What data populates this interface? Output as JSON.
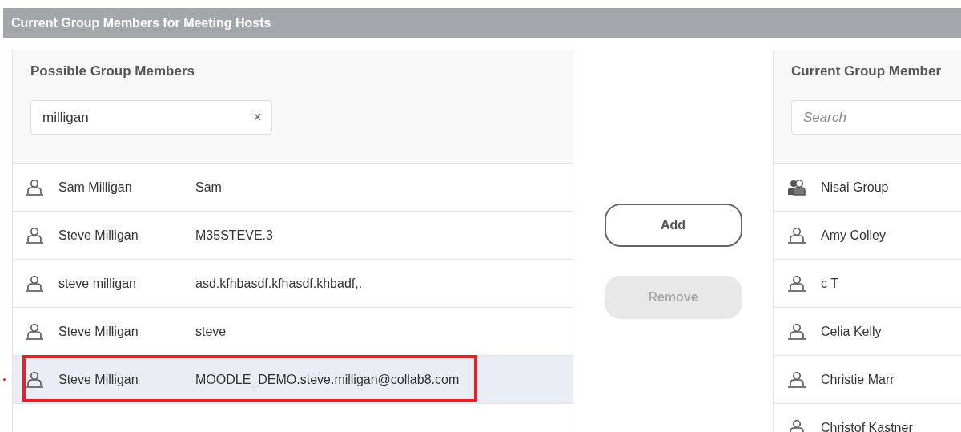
{
  "header": {
    "title": "Current Group Members for Meeting Hosts"
  },
  "possible_members": {
    "heading": "Possible Group Members",
    "search": {
      "value": "milligan",
      "clear": "×"
    },
    "rows": [
      {
        "kind": "user",
        "name": "Sam Milligan",
        "login": "Sam",
        "selected": false,
        "highlighted": false
      },
      {
        "kind": "user",
        "name": "Steve Milligan",
        "login": "M35STEVE.3",
        "selected": false,
        "highlighted": false
      },
      {
        "kind": "user",
        "name": "steve milligan",
        "login": "asd.kfhbasdf.kfhasdf.khbadf,.",
        "selected": false,
        "highlighted": false
      },
      {
        "kind": "user",
        "name": "Steve Milligan",
        "login": "steve",
        "selected": false,
        "highlighted": false
      },
      {
        "kind": "user",
        "name": "Steve Milligan",
        "login": "MOODLE_DEMO.steve.milligan@collab8.com",
        "selected": true,
        "highlighted": true
      }
    ]
  },
  "actions": [
    {
      "label": "Add",
      "disabled": false
    },
    {
      "label": "Remove",
      "disabled": true
    }
  ],
  "current_members": {
    "heading": "Current Group Member",
    "search": {
      "placeholder": "Search"
    },
    "rows": [
      {
        "kind": "group",
        "name": "Nisai Group"
      },
      {
        "kind": "user",
        "name": "Amy Colley"
      },
      {
        "kind": "user",
        "name": "c T"
      },
      {
        "kind": "user",
        "name": "Celia Kelly"
      },
      {
        "kind": "user",
        "name": "Christie Marr"
      },
      {
        "kind": "user",
        "name": "Christof Kastner"
      }
    ]
  }
}
